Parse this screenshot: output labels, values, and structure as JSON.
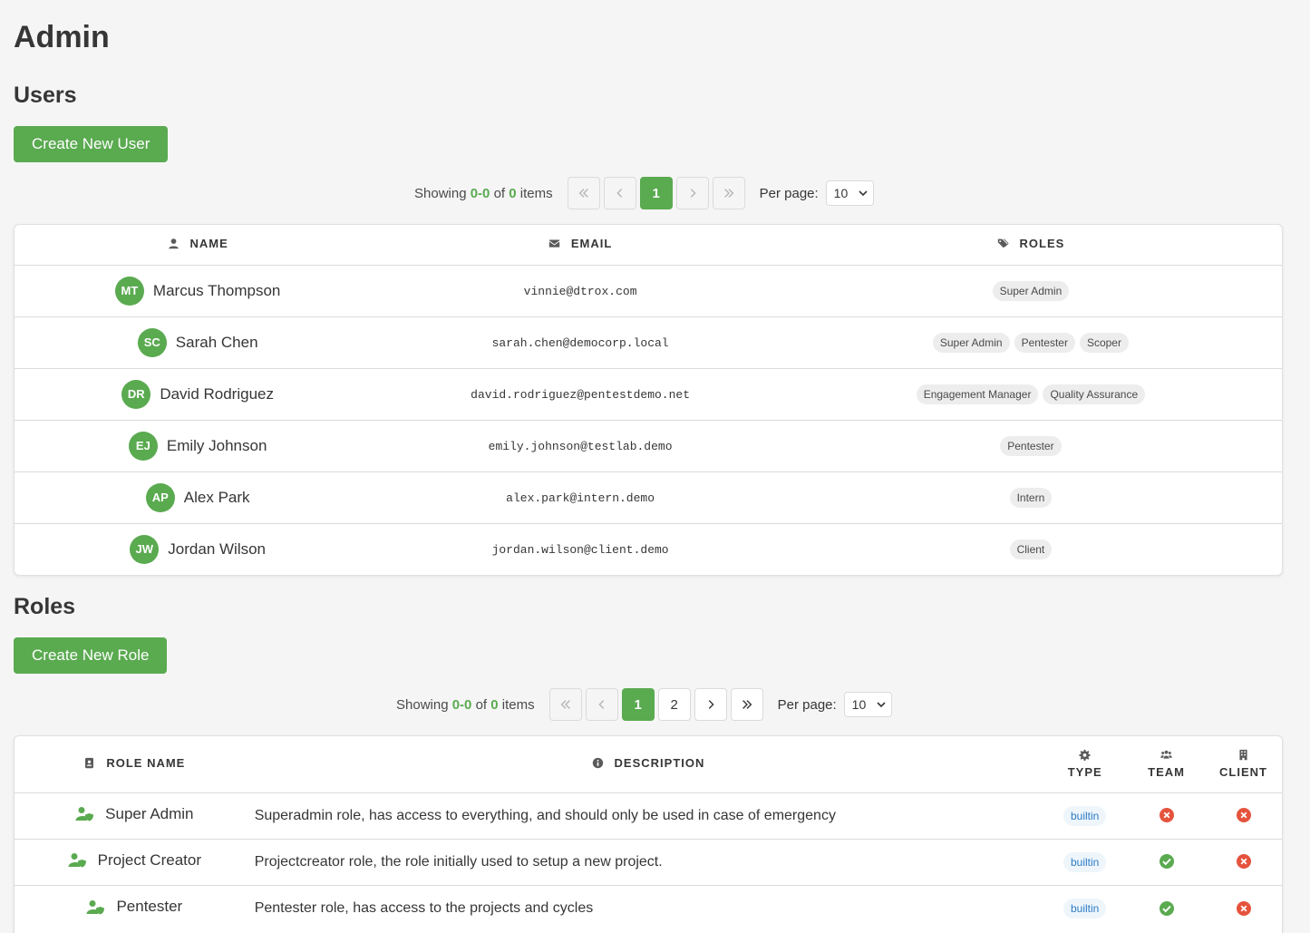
{
  "page": {
    "title": "Admin"
  },
  "users": {
    "title": "Users",
    "create_label": "Create New User",
    "pager": {
      "showing_prefix": "Showing",
      "range": "0-0",
      "of": "of",
      "total": "0",
      "items": "items",
      "pages": [
        "1"
      ],
      "per_page_label": "Per page:",
      "per_page_value": "10"
    },
    "columns": {
      "name": "Name",
      "email": "Email",
      "roles": "Roles"
    },
    "rows": [
      {
        "initials": "MT",
        "name": "Marcus Thompson",
        "email": "vinnie@dtrox.com",
        "roles": [
          "Super Admin"
        ]
      },
      {
        "initials": "SC",
        "name": "Sarah Chen",
        "email": "sarah.chen@democorp.local",
        "roles": [
          "Super Admin",
          "Pentester",
          "Scoper"
        ]
      },
      {
        "initials": "DR",
        "name": "David Rodriguez",
        "email": "david.rodriguez@pentestdemo.net",
        "roles": [
          "Engagement Manager",
          "Quality Assurance"
        ]
      },
      {
        "initials": "EJ",
        "name": "Emily Johnson",
        "email": "emily.johnson@testlab.demo",
        "roles": [
          "Pentester"
        ]
      },
      {
        "initials": "AP",
        "name": "Alex Park",
        "email": "alex.park@intern.demo",
        "roles": [
          "Intern"
        ]
      },
      {
        "initials": "JW",
        "name": "Jordan Wilson",
        "email": "jordan.wilson@client.demo",
        "roles": [
          "Client"
        ]
      }
    ]
  },
  "roles": {
    "title": "Roles",
    "create_label": "Create New Role",
    "pager": {
      "showing_prefix": "Showing",
      "range": "0-0",
      "of": "of",
      "total": "0",
      "items": "items",
      "pages": [
        "1",
        "2"
      ],
      "per_page_label": "Per page:",
      "per_page_value": "10"
    },
    "columns": {
      "role_name": "Role Name",
      "description": "Description",
      "type": "Type",
      "team": "Team",
      "client": "Client"
    },
    "rows": [
      {
        "name": "Super Admin",
        "description": "Superadmin role, has access to everything, and should only be used in case of emergency",
        "type": "builtin",
        "team": false,
        "client": false
      },
      {
        "name": "Project Creator",
        "description": "Projectcreator role, the role initially used to setup a new project.",
        "type": "builtin",
        "team": true,
        "client": false
      },
      {
        "name": "Pentester",
        "description": "Pentester role, has access to the projects and cycles",
        "type": "builtin",
        "team": true,
        "client": false
      }
    ]
  },
  "colors": {
    "accent": "#5aaa50",
    "danger": "#e5533d",
    "builtin": "#2e7bc4"
  }
}
